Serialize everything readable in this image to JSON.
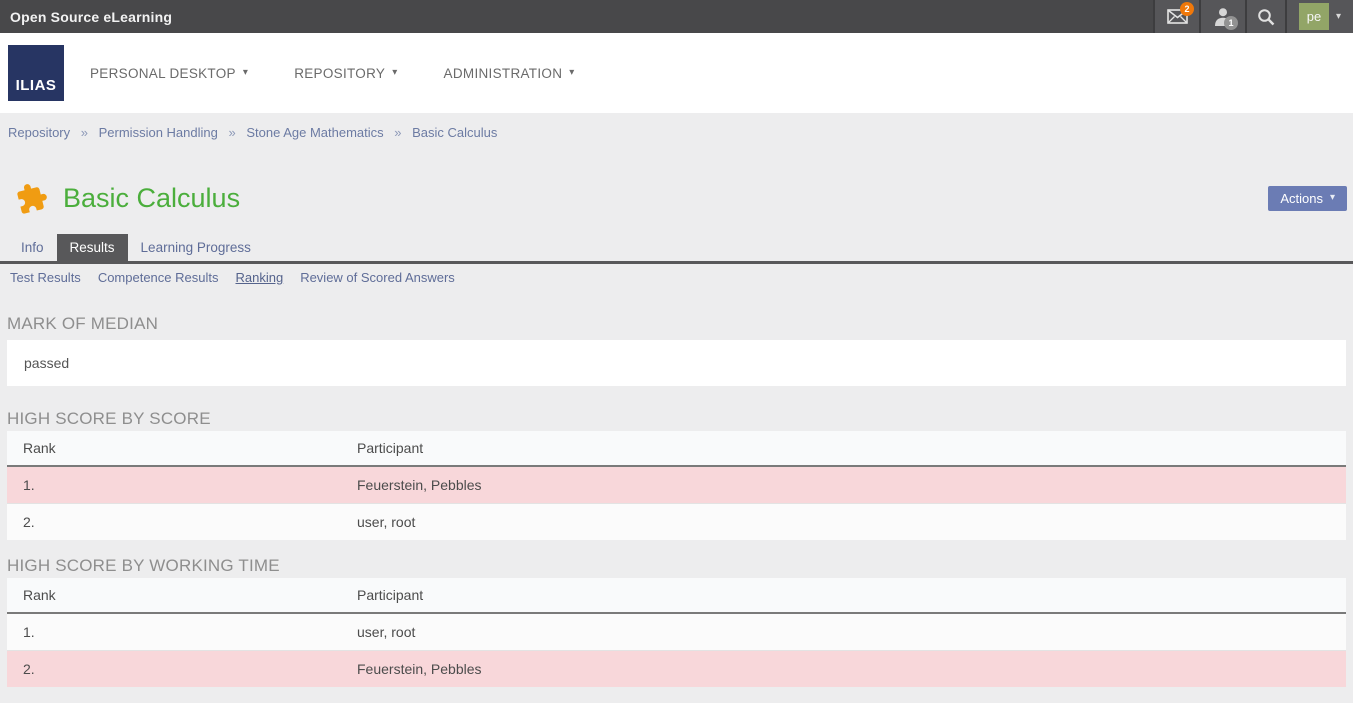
{
  "topbar": {
    "title": "Open Source eLearning",
    "mail_badge": "2",
    "user_badge": "1",
    "avatar_initials": "pe"
  },
  "icons": {
    "caret_down": "▾"
  },
  "nav": {
    "logo_text": "ILIAS",
    "items": [
      {
        "label": "PERSONAL DESKTOP"
      },
      {
        "label": "REPOSITORY"
      },
      {
        "label": "ADMINISTRATION"
      }
    ]
  },
  "breadcrumb": {
    "separator": "»",
    "items": [
      "Repository",
      "Permission Handling",
      "Stone Age Mathematics",
      "Basic Calculus"
    ]
  },
  "page": {
    "title": "Basic Calculus",
    "actions_label": "Actions"
  },
  "tabs": [
    {
      "label": "Info",
      "active": false
    },
    {
      "label": "Results",
      "active": true
    },
    {
      "label": "Learning Progress",
      "active": false
    }
  ],
  "subtabs": [
    {
      "label": "Test Results",
      "active": false
    },
    {
      "label": "Competence Results",
      "active": false
    },
    {
      "label": "Ranking",
      "active": true
    },
    {
      "label": "Review of Scored Answers",
      "active": false
    }
  ],
  "sections": {
    "median": {
      "heading": "MARK OF MEDIAN",
      "value": "passed"
    },
    "high_score_by_score": {
      "heading": "HIGH SCORE BY SCORE",
      "columns": [
        "Rank",
        "Participant"
      ],
      "rows": [
        {
          "rank": "1.",
          "participant": "Feuerstein, Pebbles",
          "highlight": true
        },
        {
          "rank": "2.",
          "participant": "user, root",
          "highlight": false
        }
      ]
    },
    "high_score_by_time": {
      "heading": "HIGH SCORE BY WORKING TIME",
      "columns": [
        "Rank",
        "Participant"
      ],
      "rows": [
        {
          "rank": "1.",
          "participant": "user, root",
          "highlight": false
        },
        {
          "rank": "2.",
          "participant": "Feuerstein, Pebbles",
          "highlight": true
        }
      ]
    }
  },
  "colors": {
    "topbar_bg": "#48484a",
    "accent_blue": "#6b7cb4",
    "title_green": "#4bae3c",
    "icon_orange": "#f09c12",
    "badge_orange": "#f0780a",
    "avatar_green": "#92a567",
    "logo_navy": "#273563",
    "highlight_pink": "#f8d7da",
    "active_tab_gray": "#58585a"
  }
}
